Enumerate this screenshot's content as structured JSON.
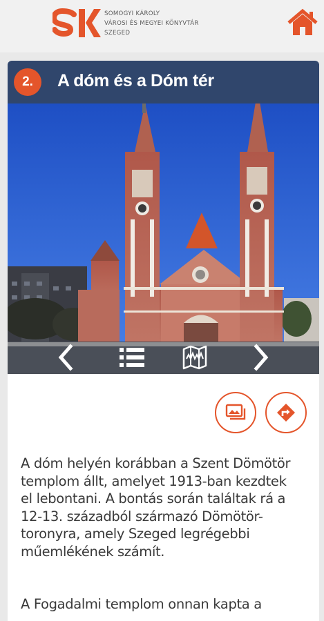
{
  "header": {
    "logo_letters": "SK",
    "org_name_lines": [
      "SOMOGYI KÁROLY",
      "VÁROSI ÉS MEGYEI KÖNYVTÁR",
      "SZEGED"
    ],
    "home_icon": "home-icon"
  },
  "station": {
    "number": "2.",
    "title": "A dóm és a Dóm tér"
  },
  "photo": {
    "subject": "cathedral-photo"
  },
  "nav": {
    "prev_icon": "chevron-left-icon",
    "list_icon": "list-icon",
    "map_icon": "city-map-icon",
    "next_icon": "chevron-right-icon"
  },
  "actions": {
    "gallery_icon": "gallery-icon",
    "directions_icon": "directions-icon"
  },
  "content": {
    "paragraph1_lines": [
      "A dóm helyén korábban a Szent Dömötör",
      "templom állt, amelyet 1913-ban kezdtek",
      "el lebontani. A bontás során találtak rá a",
      "12-13. századból származó Dömötör-",
      "toronyra, amely Szeged legrégebbi",
      "műemlékének számít."
    ],
    "paragraph2_lines": [
      "A Fogadalmi templom onnan kapta a"
    ]
  },
  "colors": {
    "accent": "#e4552b",
    "title_bar": "#30466c",
    "text": "#3a3a3a"
  }
}
